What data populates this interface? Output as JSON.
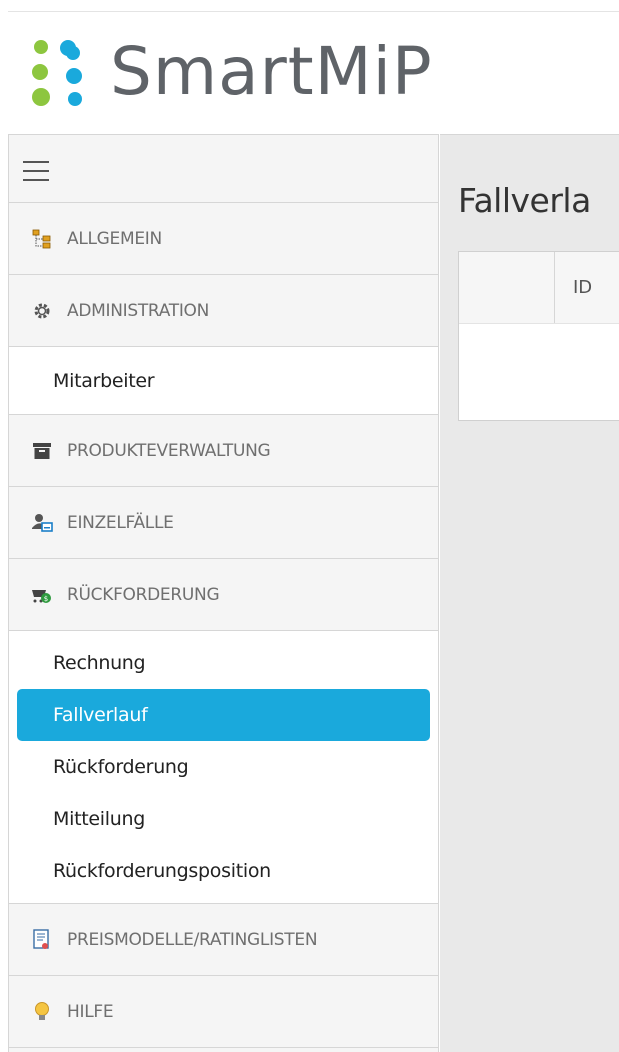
{
  "brand": {
    "name": "SmartMiP",
    "colors": {
      "green": "#8dc63f",
      "blue": "#1aa9dc",
      "gray": "#5f6368"
    }
  },
  "sidebar": {
    "menu_icon": "hamburger-icon",
    "sections": [
      {
        "label": "ALLGEMEIN",
        "icon": "org-chart-icon"
      },
      {
        "label": "ADMINISTRATION",
        "icon": "gear-icon",
        "items": [
          "Mitarbeiter"
        ]
      },
      {
        "label": "PRODUKTEVERWALTUNG",
        "icon": "archive-box-icon"
      },
      {
        "label": "EINZELFÄLLE",
        "icon": "person-card-icon"
      },
      {
        "label": "RÜCKFORDERUNG",
        "icon": "cart-money-icon",
        "items": [
          "Rechnung",
          "Fallverlauf",
          "Rückforderung",
          "Mitteilung",
          "Rückforderungsposition"
        ],
        "active_item": "Fallverlauf"
      },
      {
        "label": "PREISMODELLE/RATINGLISTEN",
        "icon": "document-list-icon"
      },
      {
        "label": "HILFE",
        "icon": "lightbulb-icon"
      }
    ]
  },
  "main": {
    "title": "Fallverla",
    "grid": {
      "columns": [
        "",
        "ID"
      ]
    }
  },
  "accent_color": "#1aa9dc"
}
